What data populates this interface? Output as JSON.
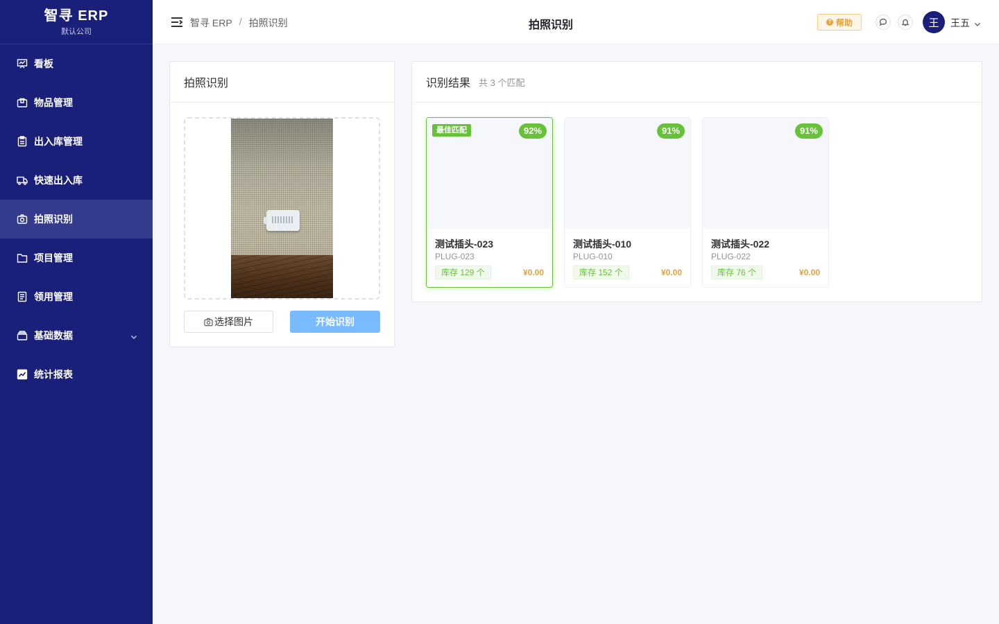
{
  "brand": {
    "title": "智寻 ERP",
    "subtitle": "默认公司"
  },
  "sidebar": {
    "items": [
      {
        "label": "看板",
        "icon": "dashboard-icon",
        "active": false
      },
      {
        "label": "物品管理",
        "icon": "package-icon",
        "active": false
      },
      {
        "label": "出入库管理",
        "icon": "clipboard-icon",
        "active": false
      },
      {
        "label": "快速出入库",
        "icon": "truck-icon",
        "active": false
      },
      {
        "label": "拍照识别",
        "icon": "camera-icon",
        "active": true
      },
      {
        "label": "项目管理",
        "icon": "folder-icon",
        "active": false
      },
      {
        "label": "领用管理",
        "icon": "document-icon",
        "active": false
      },
      {
        "label": "基础数据",
        "icon": "database-icon",
        "active": false,
        "expandable": true
      },
      {
        "label": "统计报表",
        "icon": "chart-icon",
        "active": false
      }
    ]
  },
  "header": {
    "breadcrumb": [
      "智寻 ERP",
      "拍照识别"
    ],
    "breadcrumb_sep": "/",
    "title": "拍照识别",
    "help_label": "帮助",
    "help_icon_char": "?",
    "avatar_text": "王",
    "user_name": "王五"
  },
  "upload": {
    "title": "拍照识别",
    "select_label": "选择图片",
    "start_label": "开始识别"
  },
  "results": {
    "title": "识别结果",
    "summary": "共 3 个匹配",
    "best_label": "最佳匹配",
    "items": [
      {
        "name": "测试插头-023",
        "code": "PLUG-023",
        "match": "92%",
        "stock": "库存 129 个",
        "price": "¥0.00",
        "best": true
      },
      {
        "name": "测试插头-010",
        "code": "PLUG-010",
        "match": "91%",
        "stock": "库存 152 个",
        "price": "¥0.00",
        "best": false
      },
      {
        "name": "测试插头-022",
        "code": "PLUG-022",
        "match": "91%",
        "stock": "库存 76 个",
        "price": "¥0.00",
        "best": false
      }
    ]
  },
  "colors": {
    "sidebar_bg": "#1a1f7a",
    "sidebar_active": "#343a8c",
    "primary_light": "#79bbff",
    "success": "#67c23a",
    "warning": "#e6a23c"
  }
}
